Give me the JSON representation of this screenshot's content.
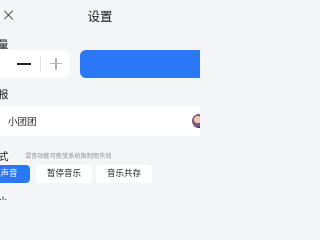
{
  "header": {
    "title": "设置"
  },
  "quantity": {
    "label": "量",
    "primary_color": "#2a78f5"
  },
  "report": {
    "label": "报",
    "name": "小团团"
  },
  "mode": {
    "label": "式",
    "hint": "混音功能可能受系统限制而失效",
    "options": [
      "声音",
      "暂停音乐",
      "音乐共存"
    ],
    "selected": "声音"
  },
  "next_section": {
    "label": "小"
  },
  "icons": {
    "close": "close-icon",
    "minus": "minus-icon",
    "plus": "plus-icon",
    "avatar": "avatar"
  }
}
